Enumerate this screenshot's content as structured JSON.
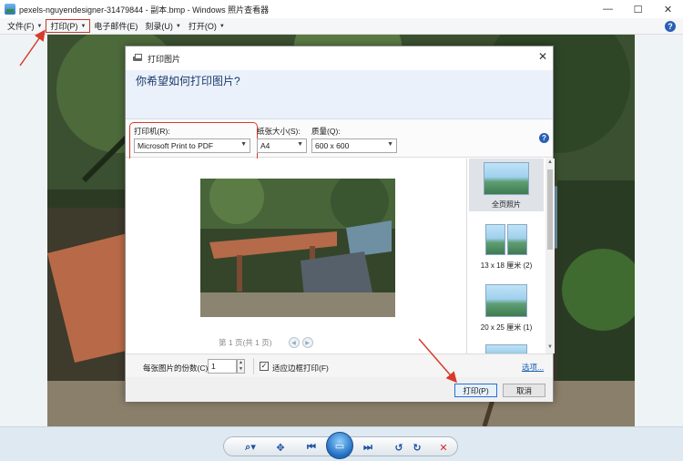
{
  "window": {
    "title": "pexels-nguyendesigner-31479844 - 副本.bmp - Windows 照片查看器",
    "minimize": "—",
    "maximize": "☐",
    "close": "✕"
  },
  "menu": {
    "items": [
      {
        "label": "文件(F)",
        "caret": "▼"
      },
      {
        "label": "打印(P)",
        "caret": "▼"
      },
      {
        "label": "电子邮件(E)"
      },
      {
        "label": "刻录(U)",
        "caret": "▼"
      },
      {
        "label": "打开(O)",
        "caret": "▼"
      }
    ],
    "help": "?"
  },
  "dialog": {
    "title": "打印图片",
    "close": "✕",
    "question": "你希望如何打印图片?",
    "printer": {
      "label": "打印机(R):",
      "value": "Microsoft Print to PDF"
    },
    "paper_size": {
      "label": "纸张大小(S):",
      "value": "A4"
    },
    "quality": {
      "label": "质量(Q):",
      "value": "600 x 600"
    },
    "help": "?",
    "page_indicator": "第 1 页(共 1 页)",
    "layouts": [
      {
        "label": "全页照片",
        "selected": true
      },
      {
        "label": "13 x 18 厘米 (2)",
        "selected": false
      },
      {
        "label": "20 x 25 厘米 (1)",
        "selected": false
      }
    ],
    "copies": {
      "label": "每张图片的份数(C):",
      "value": "1"
    },
    "fit": {
      "label": "适应边框打印(F)",
      "checked": true,
      "mark": "✓"
    },
    "options_link": "选项...",
    "print_button": "打印(P)",
    "cancel_button": "取消"
  },
  "toolbar": {
    "zoom": "search-icon",
    "fit": "fit-icon",
    "prev": "previous-icon",
    "slideshow": "slideshow-icon",
    "next": "next-icon",
    "rotate_ccw": "rotate-left-icon",
    "rotate_cw": "rotate-right-icon",
    "delete": "delete-icon"
  },
  "colors": {
    "annotation": "#d93a2a",
    "accent": "#2b5fb5"
  }
}
